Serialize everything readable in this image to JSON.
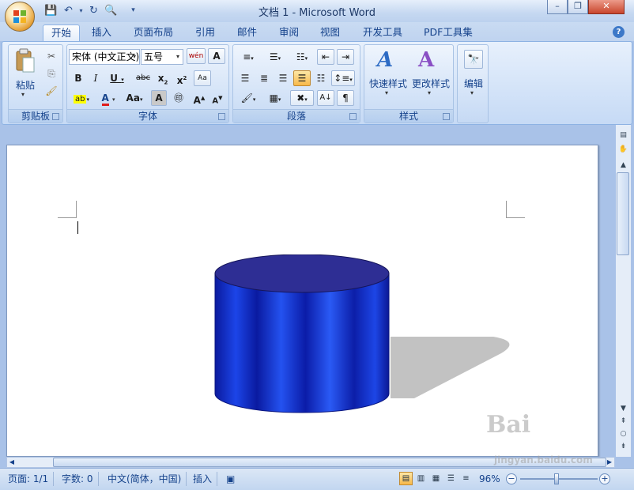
{
  "window": {
    "title": "文档 1 - Microsoft Word"
  },
  "tabs": [
    "开始",
    "插入",
    "页面布局",
    "引用",
    "邮件",
    "审阅",
    "视图",
    "开发工具",
    "PDF工具集"
  ],
  "ribbon": {
    "clipboard": {
      "label": "剪贴板",
      "paste_label": "粘贴"
    },
    "font": {
      "label": "字体",
      "font_name": "宋体 (中文正文)",
      "font_size": "五号",
      "change_case": "Aa"
    },
    "paragraph": {
      "label": "段落"
    },
    "styles": {
      "label": "样式",
      "quick_styles": "快速样式",
      "change_styles": "更改样式"
    },
    "editing": {
      "label": "编辑"
    }
  },
  "status": {
    "page": "页面: 1/1",
    "words": "字数: 0",
    "language": "中文(简体，中国)",
    "mode": "插入",
    "zoom": "96%"
  },
  "watermark": {
    "line1": "Bai",
    "line2": "jingyan.baidu.com"
  },
  "colors": {
    "accent": "#15428b",
    "ribbon": "#d3e3f8",
    "cylinder": "#0a20c8"
  }
}
